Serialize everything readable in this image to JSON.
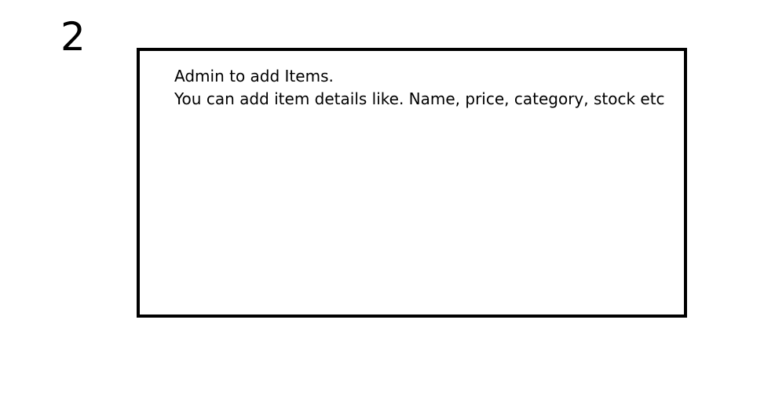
{
  "step": {
    "number": "2"
  },
  "frame": {
    "line1": "Admin to add Items.",
    "line2": "You can add item details like. Name, price, category, stock etc"
  }
}
